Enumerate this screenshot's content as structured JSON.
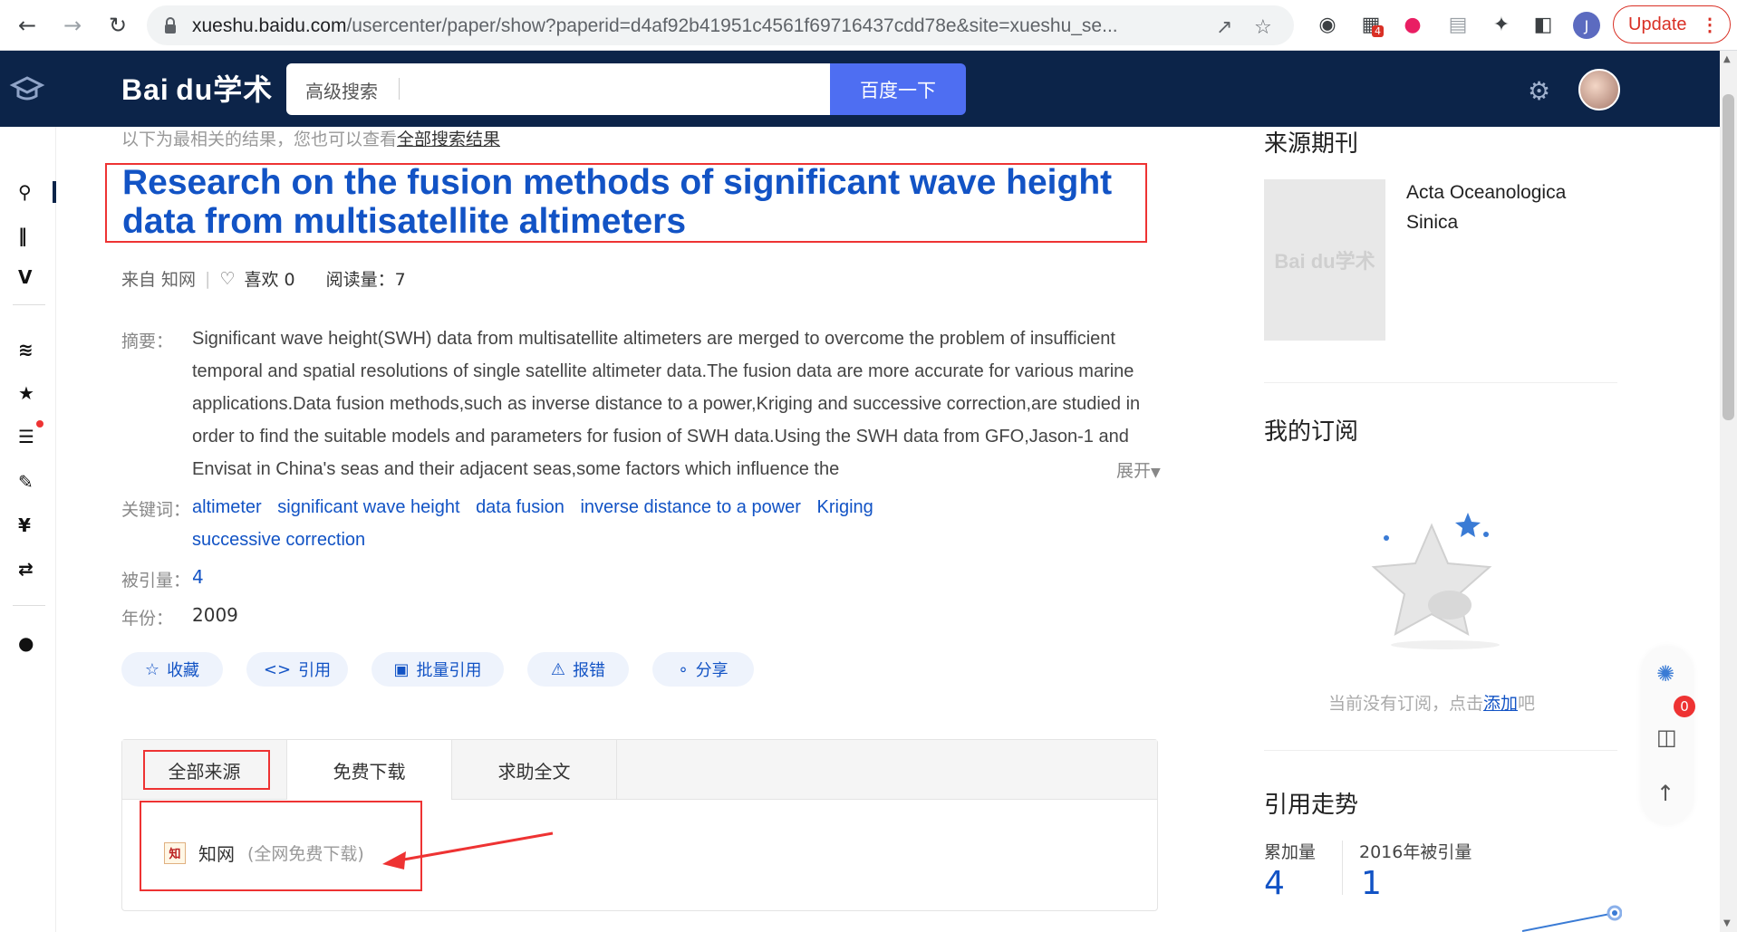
{
  "browser": {
    "url_host": "xueshu.baidu.com",
    "url_path": "/usercenter/paper/show?paperid=d4af92b41951c4561f69716437cdd78e&site=xueshu_se...",
    "extension_badge": "4",
    "profile_initial": "J",
    "update_label": "Update"
  },
  "header": {
    "brand": "Bai du学术",
    "search_placeholder": "高级搜索",
    "search_button": "百度一下"
  },
  "hint": {
    "text": "以下为最相关的结果，您也可以查看",
    "link": "全部搜索结果"
  },
  "paper": {
    "title": "Research on the fusion methods of significant wave height data from multisatellite altimeters",
    "source": "来自 知网",
    "likes": "喜欢 0",
    "reads": "阅读量：7",
    "abstract_label": "摘要：",
    "abstract": "Significant wave height(SWH) data from multisatellite altimeters are merged to overcome the problem of insufficient temporal and spatial resolutions of single satellite altimeter data.The fusion data are more accurate for various marine applications.Data fusion methods,such as inverse distance to a power,Kriging and successive correction,are studied in order to find the suitable models and parameters for fusion of SWH data.Using the SWH data from GFO,Jason-1 and Envisat in China's seas and their adjacent seas,some factors which influence the",
    "expand_label": "展开",
    "keywords_label": "关键词：",
    "keywords": [
      "altimeter",
      "significant wave height",
      "data fusion",
      "inverse distance to a power",
      "Kriging",
      "successive correction"
    ],
    "cited_label": "被引量：",
    "cited": "4",
    "year_label": "年份：",
    "year": "2009"
  },
  "actions": [
    "收藏",
    "引用",
    "批量引用",
    "报错",
    "分享"
  ],
  "tabs": [
    "全部来源",
    "免费下载",
    "求助全文"
  ],
  "source_item": {
    "name": "知网",
    "note": "(全网免费下载)",
    "icon_text": "知"
  },
  "right": {
    "journal_heading": "来源期刊",
    "journal_name": "Acta Oceanologica Sinica",
    "cover_text": "Bai du学术",
    "subscribe_heading": "我的订阅",
    "empty_text": "当前没有订阅，点击",
    "empty_link": "添加",
    "empty_suffix": "吧",
    "trend_heading": "引用走势",
    "total_label": "累加量",
    "total_value": "4",
    "year_label": "2016年被引量",
    "year_value": "1"
  },
  "float": {
    "badge": "0"
  },
  "colors": {
    "header_bg": "#0c2449",
    "link_blue": "#1253c5",
    "search_button": "#4e6ef2",
    "annotation_red": "#e33"
  }
}
